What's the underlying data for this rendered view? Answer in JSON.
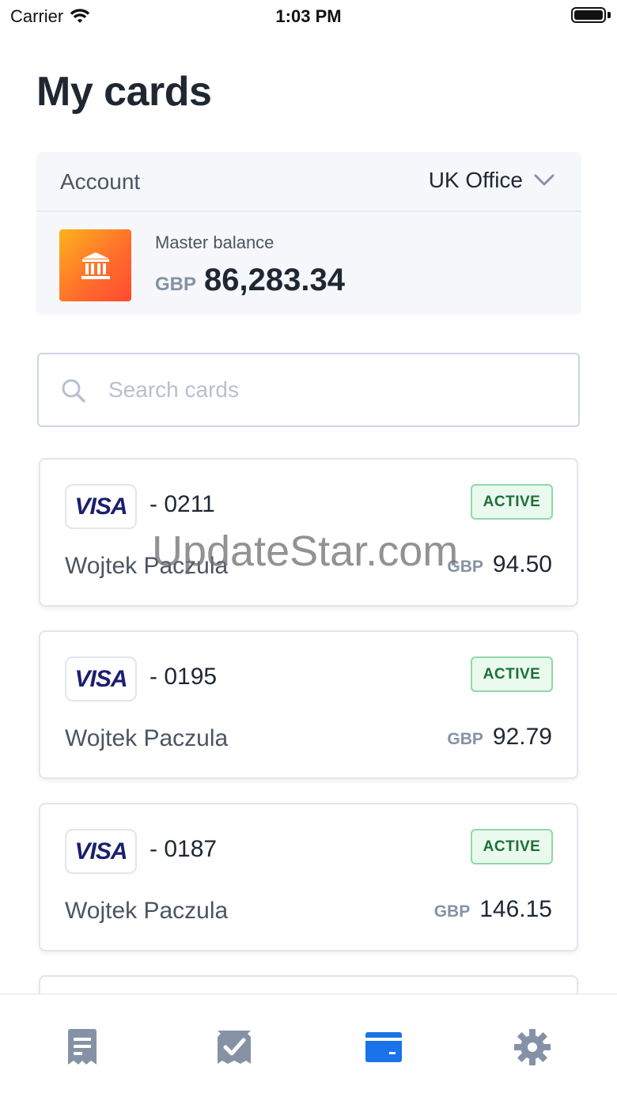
{
  "status_bar": {
    "carrier": "Carrier",
    "time": "1:03 PM"
  },
  "page": {
    "title": "My cards"
  },
  "account": {
    "label": "Account",
    "selected": "UK Office",
    "balance_label": "Master balance",
    "balance_currency": "GBP",
    "balance_amount": "86,283.34"
  },
  "search": {
    "placeholder": "Search cards"
  },
  "cards": [
    {
      "brand": "VISA",
      "number": "- 0211",
      "status": "ACTIVE",
      "holder": "Wojtek Paczula",
      "currency": "GBP",
      "amount": "94.50"
    },
    {
      "brand": "VISA",
      "number": "- 0195",
      "status": "ACTIVE",
      "holder": "Wojtek Paczula",
      "currency": "GBP",
      "amount": "92.79"
    },
    {
      "brand": "VISA",
      "number": "- 0187",
      "status": "ACTIVE",
      "holder": "Wojtek Paczula",
      "currency": "GBP",
      "amount": "146.15"
    }
  ],
  "watermark": "UpdateStar.com",
  "tabs": [
    {
      "icon": "document-icon",
      "active": false
    },
    {
      "icon": "receipt-check-icon",
      "active": false
    },
    {
      "icon": "credit-card-icon",
      "active": true
    },
    {
      "icon": "gear-icon",
      "active": false
    }
  ],
  "colors": {
    "accent": "#1a73e8",
    "inactive_icon": "#8592a6",
    "active_badge_bg": "#e9f9ee",
    "active_badge_border": "#8fd9a8",
    "active_badge_text": "#1e6e3a",
    "visa_blue": "#1a1f71"
  }
}
